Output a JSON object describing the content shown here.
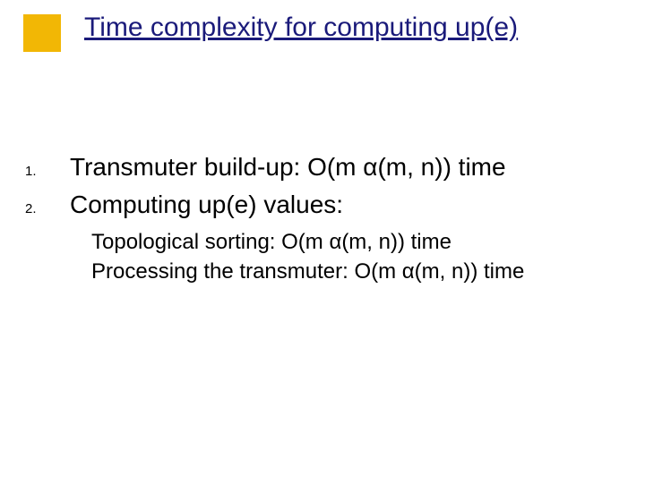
{
  "title": {
    "prefix": "Time complexity for computing ",
    "upe": "up(e)"
  },
  "items": {
    "n1": {
      "num": "1.",
      "text": "Transmuter build-up: O(m α(m, n)) time"
    },
    "n2": {
      "num": "2.",
      "text": "Computing up(e) values:"
    }
  },
  "subitems": {
    "s1": "Topological sorting: O(m α(m, n)) time",
    "s2": "Processing the transmuter: O(m α(m, n)) time"
  }
}
